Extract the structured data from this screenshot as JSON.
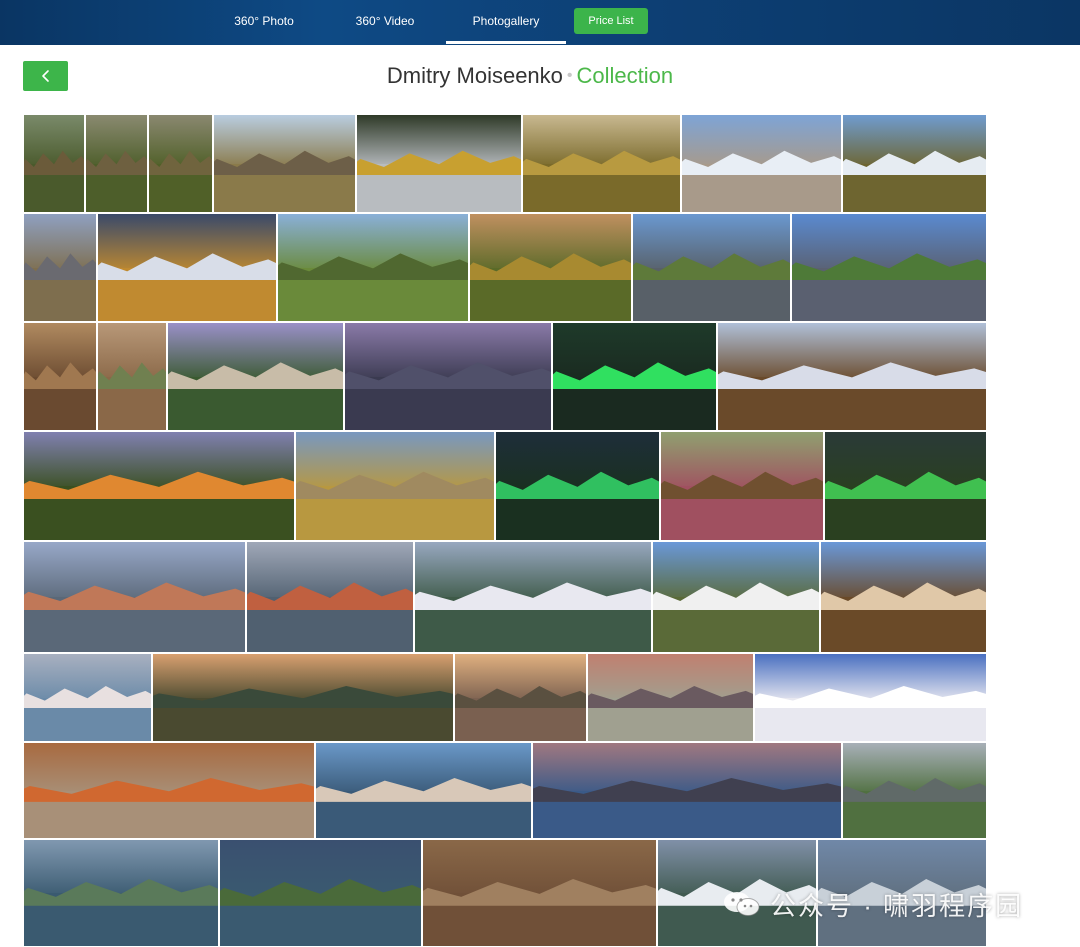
{
  "nav": {
    "tabs": [
      {
        "label": "360° Photo"
      },
      {
        "label": "360° Video"
      },
      {
        "label": "Photogallery",
        "active": true
      }
    ],
    "price_button": "Price List",
    "accent_color": "#3cb44b",
    "bar_color": "#0d3f74"
  },
  "header": {
    "back_icon": "chevron-left-icon",
    "author": "Dmitry Moiseenko",
    "separator": "•",
    "collection": "Collection"
  },
  "gallery": {
    "photos": [
      {
        "sky": "#7a8a6a",
        "ground": "#4a5a2c",
        "hill": "#6b5b3a"
      },
      {
        "sky": "#8a8a70",
        "ground": "#4d5e2a",
        "hill": "#6e6040"
      },
      {
        "sky": "#8a8870",
        "ground": "#506028",
        "hill": "#70643e"
      },
      {
        "sky": "#b9cde0",
        "ground": "#8a7a4a",
        "hill": "#6d5f48"
      },
      {
        "sky": "#2f3a28",
        "ground": "#b8bcc0",
        "hill": "#c8a030"
      },
      {
        "sky": "#c8b890",
        "ground": "#7a6a2a",
        "hill": "#b89a40"
      },
      {
        "sky": "#7ea4d6",
        "ground": "#a89a8a",
        "hill": "#e8eef5"
      },
      {
        "sky": "#6f9ccf",
        "ground": "#6e6530",
        "hill": "#e6ecf2"
      },
      {
        "sky": "#8fa0c0",
        "ground": "#7e6e4e",
        "hill": "#6a6a70"
      },
      {
        "sky": "#3a4a6a",
        "ground": "#c08a30",
        "hill": "#d8dde8"
      },
      {
        "sky": "#8ab0d8",
        "ground": "#6a8a3a",
        "hill": "#506830"
      },
      {
        "sky": "#c09060",
        "ground": "#5a6a28",
        "hill": "#a88a30"
      },
      {
        "sky": "#6a98d0",
        "ground": "#586068",
        "hill": "#5e7a3a"
      },
      {
        "sky": "#5a8ad0",
        "ground": "#5a6070",
        "hill": "#4e7a38"
      },
      {
        "sky": "#b08a60",
        "ground": "#6a4a30",
        "hill": "#a07850"
      },
      {
        "sky": "#b89878",
        "ground": "#8a6848",
        "hill": "#708050"
      },
      {
        "sky": "#9a90c8",
        "ground": "#3a5a30",
        "hill": "#c8bca8"
      },
      {
        "sky": "#8a7aa8",
        "ground": "#3a3a50",
        "hill": "#50506a"
      },
      {
        "sky": "#1e3a2a",
        "ground": "#1a2a20",
        "hill": "#30e060"
      },
      {
        "sky": "#b0c0d8",
        "ground": "#6a4a2a",
        "hill": "#d8dce8"
      },
      {
        "sky": "#8080b0",
        "ground": "#3a5020",
        "hill": "#e08830"
      },
      {
        "sky": "#7898c0",
        "ground": "#b89840",
        "hill": "#a08a60"
      },
      {
        "sky": "#1e2e3a",
        "ground": "#1a3020",
        "hill": "#30c060"
      },
      {
        "sky": "#90a070",
        "ground": "#a05060",
        "hill": "#705030"
      },
      {
        "sky": "#2a3a38",
        "ground": "#2a4020",
        "hill": "#40c050"
      },
      {
        "sky": "#98a8c8",
        "ground": "#5a6878",
        "hill": "#c07858"
      },
      {
        "sky": "#a0a8b8",
        "ground": "#506070",
        "hill": "#c06040"
      },
      {
        "sky": "#98a8c0",
        "ground": "#3e5a48",
        "hill": "#e8e8f0"
      },
      {
        "sky": "#6a98d8",
        "ground": "#5a6a38",
        "hill": "#f0f0f0"
      },
      {
        "sky": "#6a98d8",
        "ground": "#6a4a28",
        "hill": "#e0c8a8"
      },
      {
        "sky": "#a8b0c0",
        "ground": "#6a8aa8",
        "hill": "#e8e0e0"
      },
      {
        "sky": "#d8a070",
        "ground": "#4a4a30",
        "hill": "#3a4a3a"
      },
      {
        "sky": "#e0b080",
        "ground": "#7a6050",
        "hill": "#5a5040"
      },
      {
        "sky": "#c08070",
        "ground": "#a0a090",
        "hill": "#6a5a60"
      },
      {
        "sky": "#4a70c0",
        "ground": "#e8e8f0",
        "hill": "#ffffff"
      },
      {
        "sky": "#a86a40",
        "ground": "#a89078",
        "hill": "#d06830"
      },
      {
        "sky": "#6a98c8",
        "ground": "#3a5a78",
        "hill": "#d8c8b8"
      },
      {
        "sky": "#a07880",
        "ground": "#3a5a88",
        "hill": "#404050"
      },
      {
        "sky": "#a8b0b8",
        "ground": "#507040",
        "hill": "#606a68"
      },
      {
        "sky": "#8098b0",
        "ground": "#3a5a70",
        "hill": "#5a7a5a"
      },
      {
        "sky": "#3a5070",
        "ground": "#3a5a70",
        "hill": "#4a6a3a"
      },
      {
        "sky": "#8a6848",
        "ground": "#705038",
        "hill": "#a08060"
      },
      {
        "sky": "#8090a8",
        "ground": "#405a50",
        "hill": "#e8ecf0"
      },
      {
        "sky": "#7088a8",
        "ground": "#607080",
        "hill": "#c8d0d8"
      }
    ]
  },
  "watermark": {
    "icon": "wechat-icon",
    "text": "公众号 · 啸羽程序园"
  }
}
